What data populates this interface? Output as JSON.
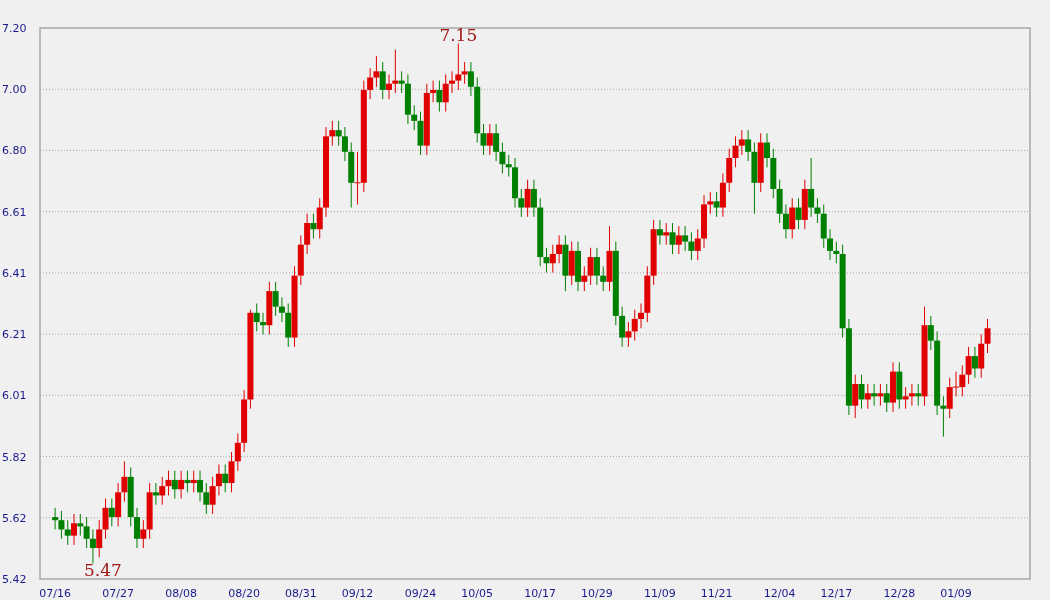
{
  "chart": {
    "chart_data": {
      "type": "candlestick",
      "ylim": [
        5.42,
        7.2
      ],
      "yticks": [
        {
          "value": 5.42,
          "label": "5.42"
        },
        {
          "value": 5.6178,
          "label": "5.62"
        },
        {
          "value": 5.8156,
          "label": "5.82"
        },
        {
          "value": 6.0133,
          "label": "6.01"
        },
        {
          "value": 6.2111,
          "label": "6.21"
        },
        {
          "value": 6.4089,
          "label": "6.41"
        },
        {
          "value": 6.6067,
          "label": "6.61"
        },
        {
          "value": 6.8044,
          "label": "6.80"
        },
        {
          "value": 7.0022,
          "label": "7.00"
        },
        {
          "value": 7.2,
          "label": "7.20"
        }
      ],
      "categories": [
        "07/16",
        null,
        null,
        null,
        null,
        null,
        null,
        null,
        null,
        null,
        "07/27",
        null,
        null,
        null,
        null,
        null,
        null,
        null,
        null,
        null,
        "08/08",
        null,
        null,
        null,
        null,
        null,
        null,
        null,
        null,
        null,
        "08/20",
        null,
        null,
        null,
        null,
        null,
        null,
        null,
        null,
        "08/31",
        null,
        null,
        null,
        null,
        null,
        null,
        null,
        null,
        "09/12",
        null,
        null,
        null,
        null,
        null,
        null,
        null,
        null,
        null,
        "09/24",
        null,
        null,
        null,
        null,
        null,
        null,
        null,
        null,
        "10/05",
        null,
        null,
        null,
        null,
        null,
        null,
        null,
        null,
        null,
        "10/17",
        null,
        null,
        null,
        null,
        null,
        null,
        null,
        null,
        "10/29",
        null,
        null,
        null,
        null,
        null,
        null,
        null,
        null,
        null,
        "11/09",
        null,
        null,
        null,
        null,
        null,
        null,
        null,
        null,
        "11/21",
        null,
        null,
        null,
        null,
        null,
        null,
        null,
        null,
        null,
        "12/04",
        null,
        null,
        null,
        null,
        null,
        null,
        null,
        null,
        "12/17",
        null,
        null,
        null,
        null,
        null,
        null,
        null,
        null,
        null,
        "12/28",
        null,
        null,
        null,
        null,
        null,
        null,
        null,
        null,
        "01/09",
        null,
        null,
        null,
        null,
        null
      ],
      "grid": true,
      "annotations": [
        "7.15",
        "5.47"
      ],
      "ohlc": [
        [
          5.62,
          5.65,
          5.58,
          5.61
        ],
        [
          5.61,
          5.64,
          5.55,
          5.58
        ],
        [
          5.58,
          5.61,
          5.53,
          5.56
        ],
        [
          5.56,
          5.63,
          5.53,
          5.6
        ],
        [
          5.6,
          5.63,
          5.56,
          5.59
        ],
        [
          5.59,
          5.62,
          5.52,
          5.55
        ],
        [
          5.55,
          5.58,
          5.47,
          5.52
        ],
        [
          5.52,
          5.61,
          5.49,
          5.58
        ],
        [
          5.58,
          5.68,
          5.55,
          5.65
        ],
        [
          5.65,
          5.68,
          5.59,
          5.62
        ],
        [
          5.62,
          5.73,
          5.59,
          5.7
        ],
        [
          5.7,
          5.8,
          5.67,
          5.75
        ],
        [
          5.75,
          5.78,
          5.59,
          5.62
        ],
        [
          5.62,
          5.65,
          5.52,
          5.55
        ],
        [
          5.55,
          5.61,
          5.52,
          5.58
        ],
        [
          5.58,
          5.73,
          5.55,
          5.7
        ],
        [
          5.7,
          5.73,
          5.66,
          5.69
        ],
        [
          5.69,
          5.75,
          5.66,
          5.72
        ],
        [
          5.72,
          5.77,
          5.69,
          5.74
        ],
        [
          5.74,
          5.77,
          5.68,
          5.71
        ],
        [
          5.71,
          5.77,
          5.68,
          5.74
        ],
        [
          5.74,
          5.77,
          5.7,
          5.73
        ],
        [
          5.73,
          5.77,
          5.7,
          5.74
        ],
        [
          5.74,
          5.77,
          5.67,
          5.7
        ],
        [
          5.7,
          5.73,
          5.63,
          5.66
        ],
        [
          5.66,
          5.75,
          5.63,
          5.72
        ],
        [
          5.72,
          5.79,
          5.69,
          5.76
        ],
        [
          5.76,
          5.79,
          5.7,
          5.73
        ],
        [
          5.73,
          5.83,
          5.7,
          5.8
        ],
        [
          5.8,
          5.89,
          5.77,
          5.86
        ],
        [
          5.86,
          6.03,
          5.83,
          6.0
        ],
        [
          6.0,
          6.29,
          5.97,
          6.28
        ],
        [
          6.28,
          6.31,
          6.22,
          6.25
        ],
        [
          6.25,
          6.28,
          6.21,
          6.24
        ],
        [
          6.24,
          6.38,
          6.21,
          6.35
        ],
        [
          6.35,
          6.38,
          6.27,
          6.3
        ],
        [
          6.3,
          6.33,
          6.25,
          6.28
        ],
        [
          6.28,
          6.31,
          6.17,
          6.2
        ],
        [
          6.2,
          6.43,
          6.17,
          6.4
        ],
        [
          6.4,
          6.53,
          6.37,
          6.5
        ],
        [
          6.5,
          6.6,
          6.47,
          6.57
        ],
        [
          6.57,
          6.6,
          6.52,
          6.55
        ],
        [
          6.55,
          6.65,
          6.52,
          6.62
        ],
        [
          6.62,
          6.88,
          6.59,
          6.85
        ],
        [
          6.85,
          6.9,
          6.82,
          6.87
        ],
        [
          6.87,
          6.9,
          6.82,
          6.85
        ],
        [
          6.85,
          6.88,
          6.77,
          6.8
        ],
        [
          6.8,
          6.83,
          6.62,
          6.7
        ],
        [
          6.7,
          6.8,
          6.63,
          6.7
        ],
        [
          6.7,
          7.03,
          6.67,
          7.0
        ],
        [
          7.0,
          7.07,
          6.97,
          7.04
        ],
        [
          7.04,
          7.11,
          7.01,
          7.06
        ],
        [
          7.06,
          7.09,
          6.97,
          7.0
        ],
        [
          7.0,
          7.05,
          6.97,
          7.02
        ],
        [
          7.02,
          7.13,
          6.99,
          7.03
        ],
        [
          7.03,
          7.06,
          6.99,
          7.02
        ],
        [
          7.02,
          7.05,
          6.89,
          6.92
        ],
        [
          6.92,
          6.95,
          6.87,
          6.9
        ],
        [
          6.9,
          6.93,
          6.79,
          6.82
        ],
        [
          6.82,
          7.02,
          6.79,
          6.99
        ],
        [
          6.99,
          7.03,
          6.96,
          7.0
        ],
        [
          7.0,
          7.03,
          6.93,
          6.96
        ],
        [
          6.96,
          7.05,
          6.93,
          7.02
        ],
        [
          7.02,
          7.06,
          6.99,
          7.03
        ],
        [
          7.03,
          7.15,
          7.0,
          7.05
        ],
        [
          7.05,
          7.09,
          7.02,
          7.06
        ],
        [
          7.06,
          7.09,
          6.98,
          7.01
        ],
        [
          7.01,
          7.04,
          6.83,
          6.86
        ],
        [
          6.86,
          6.89,
          6.79,
          6.82
        ],
        [
          6.82,
          6.89,
          6.79,
          6.86
        ],
        [
          6.86,
          6.89,
          6.77,
          6.8
        ],
        [
          6.8,
          6.83,
          6.73,
          6.76
        ],
        [
          6.76,
          6.79,
          6.72,
          6.75
        ],
        [
          6.75,
          6.78,
          6.62,
          6.65
        ],
        [
          6.65,
          6.68,
          6.59,
          6.62
        ],
        [
          6.62,
          6.71,
          6.59,
          6.68
        ],
        [
          6.68,
          6.71,
          6.59,
          6.62
        ],
        [
          6.62,
          6.65,
          6.43,
          6.46
        ],
        [
          6.46,
          6.49,
          6.41,
          6.44
        ],
        [
          6.44,
          6.5,
          6.41,
          6.47
        ],
        [
          6.47,
          6.53,
          6.44,
          6.5
        ],
        [
          6.5,
          6.53,
          6.35,
          6.4
        ],
        [
          6.4,
          6.51,
          6.37,
          6.48
        ],
        [
          6.48,
          6.51,
          6.35,
          6.38
        ],
        [
          6.38,
          6.43,
          6.35,
          6.4
        ],
        [
          6.4,
          6.49,
          6.37,
          6.46
        ],
        [
          6.46,
          6.49,
          6.37,
          6.4
        ],
        [
          6.4,
          6.43,
          6.35,
          6.38
        ],
        [
          6.38,
          6.56,
          6.35,
          6.48
        ],
        [
          6.48,
          6.51,
          6.24,
          6.27
        ],
        [
          6.27,
          6.3,
          6.17,
          6.2
        ],
        [
          6.2,
          6.25,
          6.17,
          6.22
        ],
        [
          6.22,
          6.29,
          6.19,
          6.26
        ],
        [
          6.26,
          6.31,
          6.23,
          6.28
        ],
        [
          6.28,
          6.43,
          6.25,
          6.4
        ],
        [
          6.4,
          6.58,
          6.37,
          6.55
        ],
        [
          6.55,
          6.58,
          6.5,
          6.53
        ],
        [
          6.53,
          6.57,
          6.5,
          6.54
        ],
        [
          6.54,
          6.57,
          6.47,
          6.5
        ],
        [
          6.5,
          6.56,
          6.47,
          6.53
        ],
        [
          6.53,
          6.56,
          6.48,
          6.51
        ],
        [
          6.51,
          6.54,
          6.45,
          6.48
        ],
        [
          6.48,
          6.55,
          6.45,
          6.52
        ],
        [
          6.52,
          6.66,
          6.49,
          6.63
        ],
        [
          6.63,
          6.67,
          6.6,
          6.64
        ],
        [
          6.64,
          6.67,
          6.59,
          6.62
        ],
        [
          6.62,
          6.73,
          6.59,
          6.7
        ],
        [
          6.7,
          6.81,
          6.67,
          6.78
        ],
        [
          6.78,
          6.85,
          6.75,
          6.82
        ],
        [
          6.82,
          6.87,
          6.79,
          6.84
        ],
        [
          6.84,
          6.87,
          6.77,
          6.8
        ],
        [
          6.8,
          6.83,
          6.6,
          6.7
        ],
        [
          6.7,
          6.86,
          6.67,
          6.83
        ],
        [
          6.83,
          6.86,
          6.75,
          6.78
        ],
        [
          6.78,
          6.81,
          6.65,
          6.68
        ],
        [
          6.68,
          6.71,
          6.57,
          6.6
        ],
        [
          6.6,
          6.63,
          6.52,
          6.55
        ],
        [
          6.55,
          6.65,
          6.52,
          6.62
        ],
        [
          6.62,
          6.65,
          6.55,
          6.58
        ],
        [
          6.58,
          6.71,
          6.55,
          6.68
        ],
        [
          6.68,
          6.78,
          6.59,
          6.62
        ],
        [
          6.62,
          6.65,
          6.57,
          6.6
        ],
        [
          6.6,
          6.63,
          6.49,
          6.52
        ],
        [
          6.52,
          6.55,
          6.45,
          6.48
        ],
        [
          6.48,
          6.51,
          6.44,
          6.47
        ],
        [
          6.47,
          6.5,
          6.2,
          6.23
        ],
        [
          6.23,
          6.26,
          5.95,
          5.98
        ],
        [
          5.98,
          6.08,
          5.94,
          6.05
        ],
        [
          6.05,
          6.08,
          5.97,
          6.0
        ],
        [
          6.0,
          6.05,
          5.97,
          6.02
        ],
        [
          6.02,
          6.05,
          5.98,
          6.01
        ],
        [
          6.01,
          6.05,
          5.98,
          6.02
        ],
        [
          6.02,
          6.05,
          5.96,
          5.99
        ],
        [
          5.99,
          6.12,
          5.96,
          6.09
        ],
        [
          6.09,
          6.12,
          5.97,
          6.0
        ],
        [
          6.0,
          6.04,
          5.97,
          6.01
        ],
        [
          6.01,
          6.05,
          5.98,
          6.02
        ],
        [
          6.02,
          6.05,
          5.98,
          6.01
        ],
        [
          6.01,
          6.3,
          5.98,
          6.24
        ],
        [
          6.24,
          6.27,
          6.16,
          6.19
        ],
        [
          6.19,
          6.22,
          5.95,
          5.98
        ],
        [
          5.98,
          6.01,
          5.88,
          5.97
        ],
        [
          5.97,
          6.07,
          5.94,
          6.04
        ],
        [
          6.04,
          6.09,
          6.01,
          6.04
        ],
        [
          6.04,
          6.11,
          6.01,
          6.08
        ],
        [
          6.08,
          6.17,
          6.05,
          6.14
        ],
        [
          6.14,
          6.17,
          6.07,
          6.1
        ],
        [
          6.1,
          6.21,
          6.07,
          6.18
        ],
        [
          6.18,
          6.26,
          6.15,
          6.23
        ]
      ]
    }
  }
}
